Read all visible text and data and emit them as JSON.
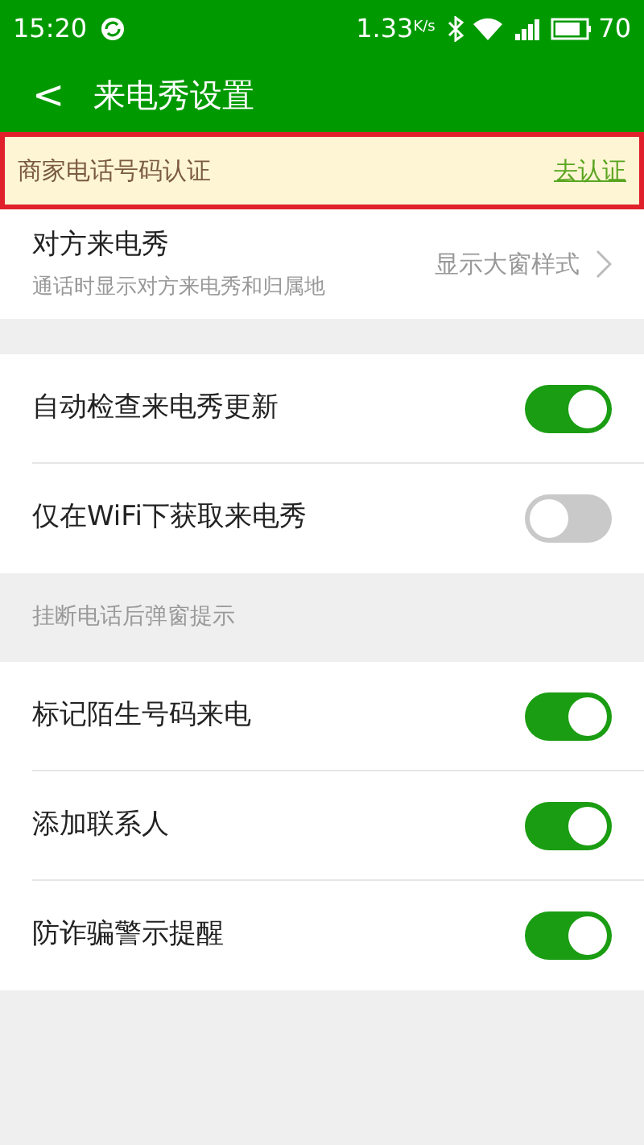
{
  "status_bar": {
    "time": "15:20",
    "speed": "1.33",
    "speed_unit": "K/s",
    "battery": "70"
  },
  "header": {
    "back": "<",
    "title": "来电秀设置"
  },
  "banner": {
    "text": "商家电话号码认证",
    "link": "去认证"
  },
  "caller_show": {
    "title": "对方来电秀",
    "subtitle": "通话时显示对方来电秀和归属地",
    "value": "显示大窗样式"
  },
  "groups": [
    {
      "items": [
        {
          "label": "自动检查来电秀更新",
          "on": true
        },
        {
          "label": "仅在WiFi下获取来电秀",
          "on": false
        }
      ]
    },
    {
      "header": "挂断电话后弹窗提示",
      "items": [
        {
          "label": "标记陌生号码来电",
          "on": true
        },
        {
          "label": "添加联系人",
          "on": true
        },
        {
          "label": "防诈骗警示提醒",
          "on": true
        }
      ]
    }
  ]
}
